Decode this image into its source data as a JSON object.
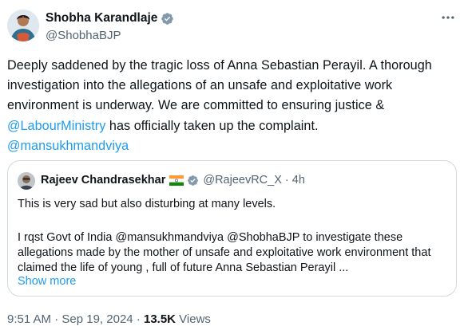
{
  "author": {
    "name": "Shobha Karandlaje",
    "handle": "@ShobhaBJP"
  },
  "tweet": {
    "text_part1": "Deeply saddened by the tragic loss of Anna Sebastian Perayil. A thorough investigation into the allegations of an unsafe and exploitative work environment is underway. We are committed to ensuring justice & ",
    "mention1": "@LabourMinistry",
    "text_part2": " has officially taken up the complaint.",
    "mention2": "@mansukhmandviya"
  },
  "quoted": {
    "name": "Rajeev Chandrasekhar",
    "handle": "@RajeevRC_X",
    "separator": "·",
    "time": "4h",
    "line1": "This is very sad but also disturbing at many levels.",
    "line2": "I rqst Govt of India @mansukhmandviya @ShobhaBJP to investigate these allegations made by the mother of unsafe and exploitative work environment that claimed the life of young , full of future Anna Sebastian Perayil ...",
    "show_more": "Show more"
  },
  "meta": {
    "time": "9:51 AM",
    "sep1": " · ",
    "date": "Sep 19, 2024",
    "sep2": " · ",
    "views_count": "13.5K",
    "views_label": " Views"
  },
  "colors": {
    "link": "#1d9bf0",
    "text": "#0f1419",
    "muted": "#536471",
    "border": "#cfd9de"
  },
  "icons": [
    "verified-badge-icon",
    "more-icon",
    "india-flag-icon"
  ]
}
